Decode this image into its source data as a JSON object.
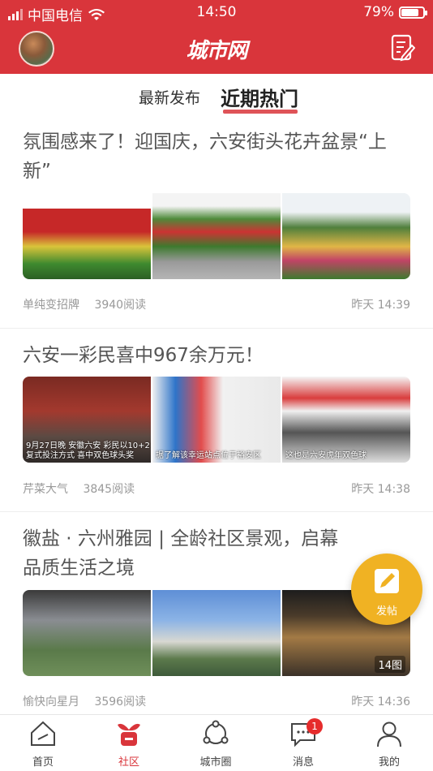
{
  "status": {
    "carrier": "中国电信",
    "time": "14:50",
    "battery": "79%",
    "battery_level": 0.79
  },
  "header": {
    "logo": "城市网",
    "avatar_icon": "user-avatar",
    "compose_icon": "edit-note-icon"
  },
  "tabs": [
    {
      "label": "最新发布",
      "active": false
    },
    {
      "label": "近期热门",
      "active": true
    }
  ],
  "posts": [
    {
      "title": "氛围感来了！迎国庆，六安街头花卉盆景“上新”",
      "author": "单纯变招牌",
      "reads": "3940阅读",
      "time": "昨天 14:39",
      "images": [
        {
          "overlay": ""
        },
        {
          "overlay": ""
        },
        {
          "overlay": ""
        }
      ],
      "image_count": ""
    },
    {
      "title": "六安一彩民喜中967余万元！",
      "author": "芹菜大气",
      "reads": "3845阅读",
      "time": "昨天 14:38",
      "images": [
        {
          "overlay": "9月27日晚 安徽六安 彩民以10+2复式投注方式 喜中双色球头奖"
        },
        {
          "overlay": "据了解该幸运站点位于裕安区"
        },
        {
          "overlay": "这也是六安虎年双色球"
        }
      ],
      "image_count": ""
    },
    {
      "title": "徽盐 · 六州雅园 | 全龄社区景观，启幕品质生活之境",
      "author": "愉快向星月",
      "reads": "3596阅读",
      "time": "昨天 14:36",
      "images": [
        {
          "overlay": ""
        },
        {
          "overlay": ""
        },
        {
          "overlay": ""
        }
      ],
      "image_count": "14图"
    }
  ],
  "fab": {
    "label": "发帖"
  },
  "bottom_nav": [
    {
      "label": "首页",
      "icon": "home-icon",
      "active": false
    },
    {
      "label": "社区",
      "icon": "community-icon",
      "active": true
    },
    {
      "label": "城市圈",
      "icon": "city-circle-icon",
      "active": false
    },
    {
      "label": "消息",
      "icon": "message-icon",
      "active": false,
      "badge": "1"
    },
    {
      "label": "我的",
      "icon": "profile-icon",
      "active": false
    }
  ],
  "colors": {
    "brand": "#d9353b",
    "fab": "#f0b223"
  }
}
